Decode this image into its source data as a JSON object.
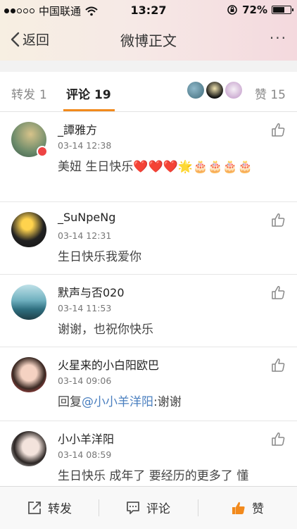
{
  "status_bar": {
    "carrier": "中国联通",
    "time": "13:27",
    "battery": "72%",
    "battery_level": 0.72
  },
  "nav": {
    "back_label": "返回",
    "title": "微博正文",
    "more_label": "···"
  },
  "tabs": {
    "repost_label": "转发",
    "repost_count": "1",
    "comment_label": "评论",
    "comment_count": "19",
    "like_label": "赞",
    "like_count": "15"
  },
  "comments": [
    {
      "name": "_譚雅方",
      "time": "03-14 12:38",
      "text": "美妞 生日快乐❤️❤️❤️🌟🎂🎂🎂🎂"
    },
    {
      "name": "_SuNpeNg",
      "time": "03-14 12:31",
      "text": "生日快乐我爱你"
    },
    {
      "name": "默声与否020",
      "time": "03-14 11:53",
      "text": "谢谢，也祝你快乐"
    },
    {
      "name": "火星来的小白阳欧巴",
      "time": "03-14 09:06",
      "text_prefix": "回复",
      "mention": "@小小羊洋阳",
      "text_suffix": ":谢谢"
    },
    {
      "name": "小小羊洋阳",
      "time": "03-14 08:59",
      "text": "生日快乐 成年了  要经历的更多了  懂"
    }
  ],
  "bottom_bar": {
    "repost_label": "转发",
    "comment_label": "评论",
    "like_label": "赞"
  },
  "colors": {
    "accent_orange": "#f28a1d",
    "mention_blue": "#4a7fbf"
  }
}
